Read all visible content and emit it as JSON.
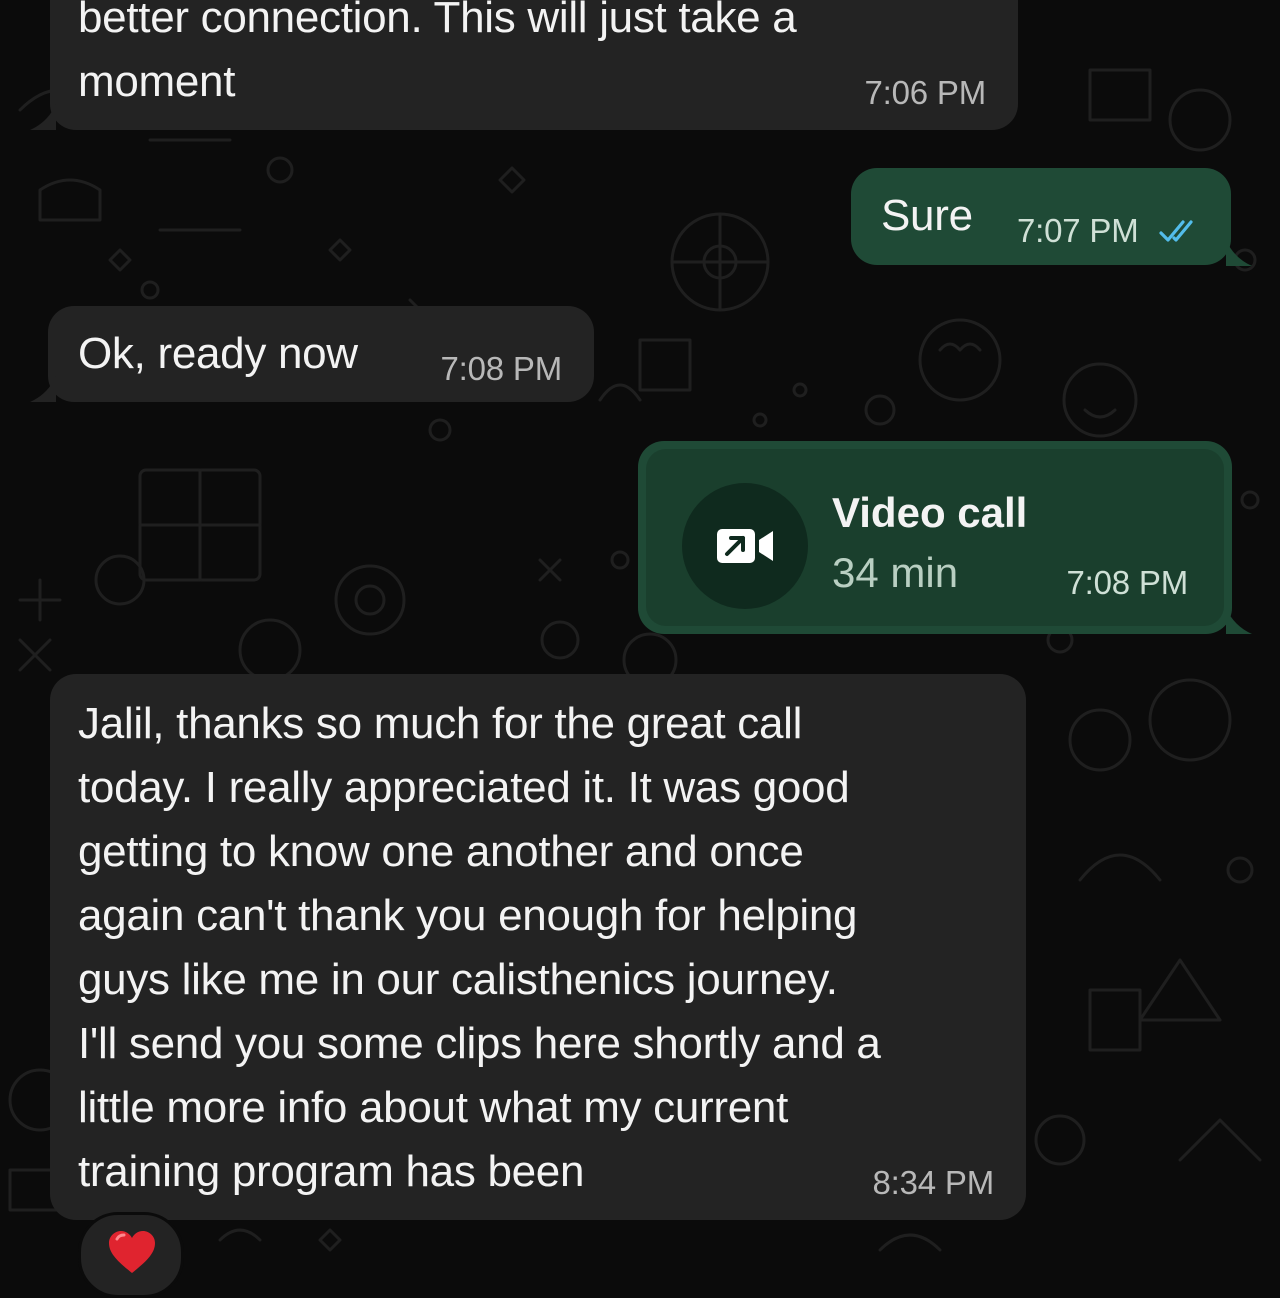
{
  "messages": [
    {
      "id": "m1",
      "direction": "incoming",
      "text": "better connection. This will just take a\nmoment",
      "time": "7:06 PM"
    },
    {
      "id": "m2",
      "direction": "outgoing",
      "text": "Sure",
      "time": "7:07 PM",
      "status": "read"
    },
    {
      "id": "m3",
      "direction": "incoming",
      "text": "Ok, ready now",
      "time": "7:08 PM"
    },
    {
      "id": "m4",
      "direction": "outgoing",
      "type": "call",
      "call_title": "Video call",
      "call_duration": "34 min",
      "time": "7:08 PM",
      "icon": "video-call-outgoing-icon"
    },
    {
      "id": "m5",
      "direction": "incoming",
      "text": "Jalil, thanks so much for the great call\ntoday. I really appreciated it. It was good\ngetting to know one another and once\nagain can't thank you enough for helping\nguys like me in our calisthenics journey.\nI'll send you some clips here shortly and a\nlittle more info about what my current\ntraining program has been",
      "time": "8:34 PM",
      "reaction": "heart-emoji"
    }
  ],
  "colors": {
    "background": "#0b0b0b",
    "incoming_bubble": "#232323",
    "outgoing_bubble": "#1f4a36",
    "read_ticks": "#53bdeb"
  }
}
